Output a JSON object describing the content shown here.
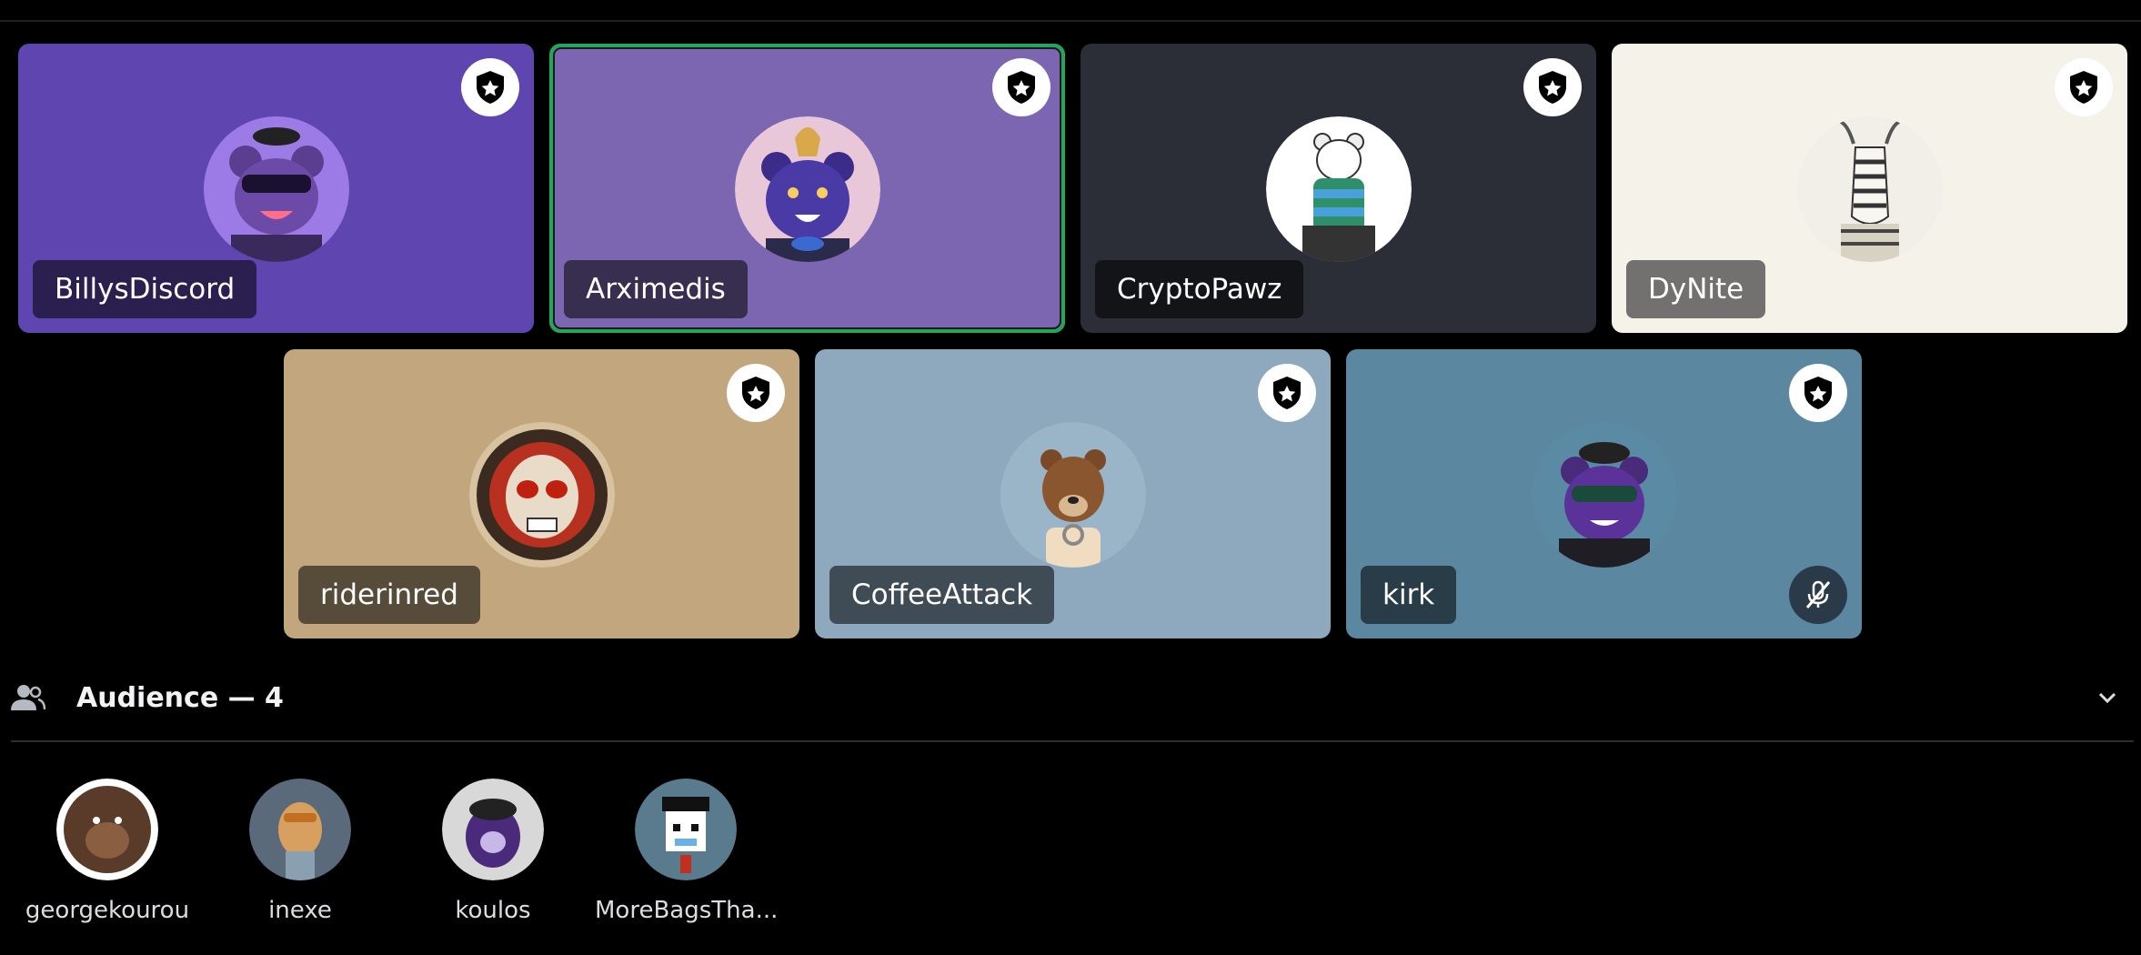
{
  "speakers": [
    {
      "name": "BillysDiscord",
      "bg": "#5f45b0",
      "speaking": false,
      "muted": false,
      "avatar": "purple-bear-avatar"
    },
    {
      "name": "Arximedis",
      "bg": "#7c66b1",
      "speaking": true,
      "muted": false,
      "avatar": "purple-bear-avatar"
    },
    {
      "name": "CryptoPawz",
      "bg": "#2b2d37",
      "speaking": false,
      "muted": false,
      "avatar": "polar-bear-avatar"
    },
    {
      "name": "DyNite",
      "bg": "#f5f2ea",
      "speaking": false,
      "muted": false,
      "avatar": "zebra-avatar"
    },
    {
      "name": "riderinred",
      "bg": "#c2a67e",
      "speaking": false,
      "muted": false,
      "avatar": "skull-avatar"
    },
    {
      "name": "CoffeeAttack",
      "bg": "#8ea9bd",
      "speaking": false,
      "muted": false,
      "avatar": "brown-bear-avatar"
    },
    {
      "name": "kirk",
      "bg": "#5b87a0",
      "speaking": false,
      "muted": true,
      "avatar": "purple-bear-avatar"
    }
  ],
  "audience": {
    "title": "Audience — 4",
    "members": [
      {
        "name": "georgekourou",
        "avatar": "gorilla-avatar"
      },
      {
        "name": "inexe",
        "avatar": "dog-avatar"
      },
      {
        "name": "koulos",
        "avatar": "purple-lion-avatar"
      },
      {
        "name": "MoreBagsTha...",
        "avatar": "pixel-punk-avatar"
      }
    ]
  },
  "icons": {
    "moderator_badge": "shield-star-icon",
    "muted": "mic-muted-icon",
    "audience": "people-icon",
    "collapse": "chevron-down-icon"
  }
}
